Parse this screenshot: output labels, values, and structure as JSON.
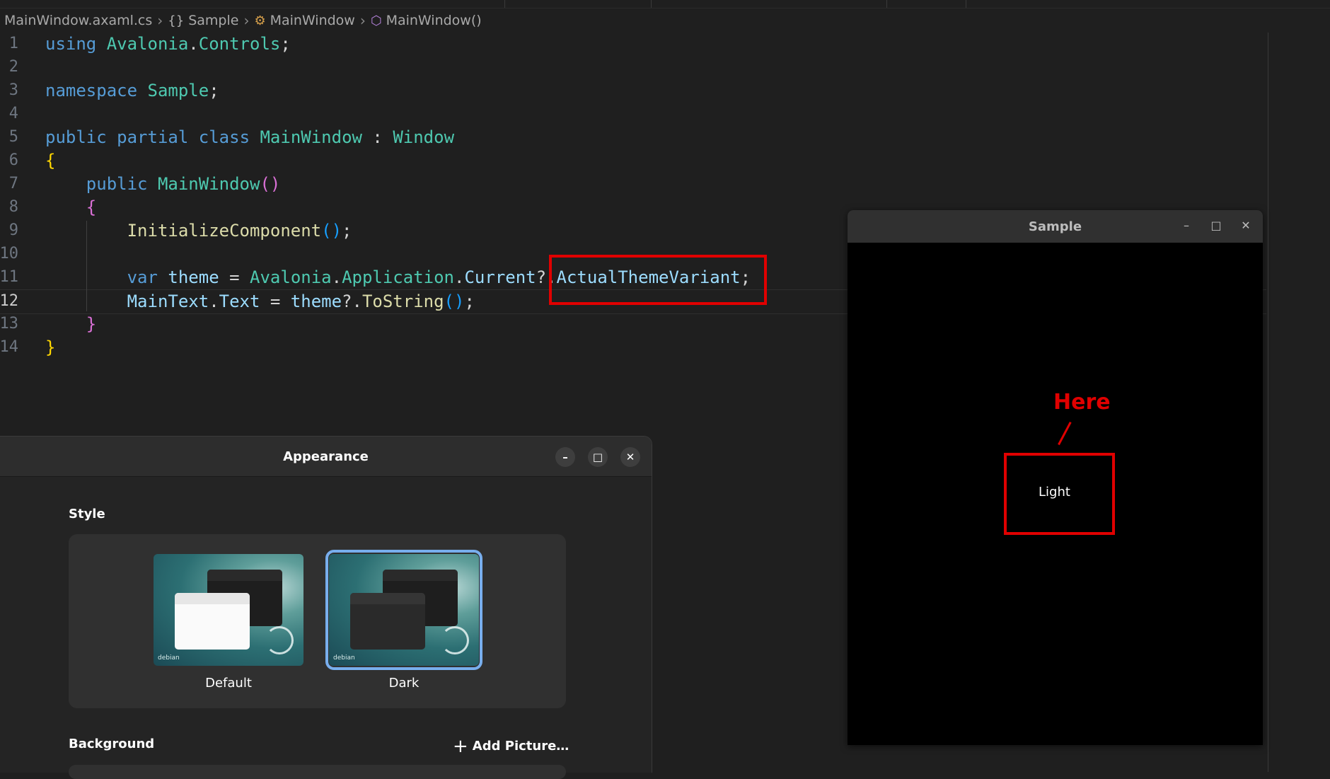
{
  "breadcrumb": {
    "file": "MainWindow.axaml.cs",
    "namespace": "Sample",
    "class": "MainWindow",
    "method": "MainWindow()"
  },
  "editor": {
    "line_numbers": [
      "1",
      "2",
      "3",
      "4",
      "5",
      "6",
      "7",
      "8",
      "9",
      "10",
      "11",
      "12",
      "13",
      "14"
    ],
    "active_line": "12",
    "lines": {
      "l1": [
        "using",
        "Avalonia",
        ".",
        "Controls",
        ";"
      ],
      "l3": [
        "namespace",
        "Sample",
        ";"
      ],
      "l5": [
        "public",
        "partial",
        "class",
        "MainWindow",
        ":",
        "Window"
      ],
      "l6": "{",
      "l7": [
        "public",
        "MainWindow",
        "(",
        ")"
      ],
      "l8": "{",
      "l9": [
        "InitializeComponent",
        "(",
        ")",
        ";"
      ],
      "l11": [
        "var",
        "theme",
        "=",
        "Avalonia",
        ".",
        "Application",
        ".",
        "Current",
        "?.",
        "ActualThemeVariant",
        ";"
      ],
      "l12": [
        "MainText",
        ".",
        "Text",
        "=",
        "theme",
        "?.",
        "ToString",
        "(",
        ")",
        ";"
      ],
      "l13": "}",
      "l14": "}"
    }
  },
  "sample_window": {
    "title": "Sample",
    "minimize": "–",
    "maximize": "□",
    "close": "✕",
    "main_text": "Light",
    "annotation": "Here"
  },
  "appearance_window": {
    "title": "Appearance",
    "minimize": "–",
    "maximize": "□",
    "close": "✕",
    "style_heading": "Style",
    "styles": [
      {
        "label": "Default",
        "selected": false
      },
      {
        "label": "Dark",
        "selected": true
      }
    ],
    "thumb_brand": "debian",
    "background_heading": "Background",
    "add_picture": "Add Picture…"
  },
  "colors": {
    "annotation_red": "#e00000",
    "selection_blue": "#78aeed"
  }
}
